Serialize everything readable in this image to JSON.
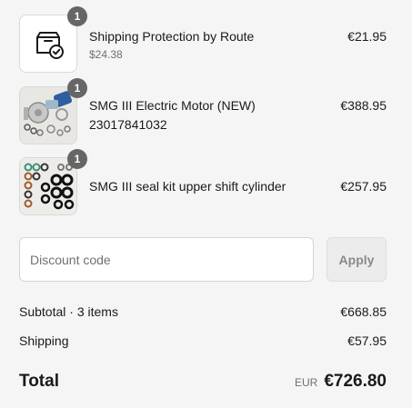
{
  "items": [
    {
      "quantity": "1",
      "title": "Shipping Protection by Route",
      "subtitle": "$24.38",
      "sku": "",
      "price": "€21.95",
      "image": "box-check-icon"
    },
    {
      "quantity": "1",
      "title": "SMG III Electric Motor (NEW)",
      "subtitle": "",
      "sku": "23017841032",
      "price": "€388.95",
      "image": "electric-motor-photo"
    },
    {
      "quantity": "1",
      "title": "SMG III seal kit upper shift cylinder",
      "subtitle": "",
      "sku": "",
      "price": "€257.95",
      "image": "seal-kit-photo"
    }
  ],
  "discount": {
    "placeholder": "Discount code",
    "value": "",
    "apply_label": "Apply"
  },
  "summary": {
    "subtotal_label": "Subtotal · 3 items",
    "subtotal_value": "€668.85",
    "shipping_label": "Shipping",
    "shipping_value": "€57.95",
    "total_label": "Total",
    "total_currency": "EUR",
    "total_value": "€726.80"
  },
  "colors": {
    "background": "#f5f5f5",
    "badge": "#666666",
    "muted_text": "#707070",
    "button_disabled": "#ececec"
  }
}
